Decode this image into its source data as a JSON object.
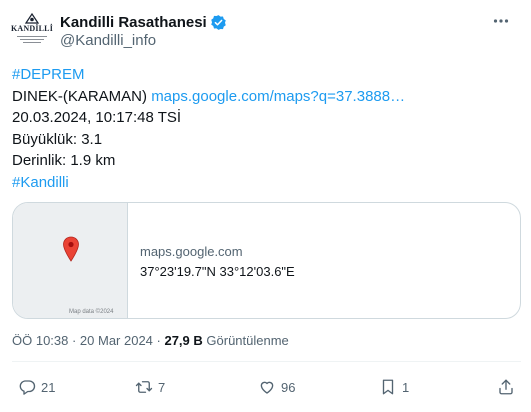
{
  "account": {
    "display_name": "Kandilli Rasathanesi",
    "handle": "@Kandilli_info",
    "avatar_word": "KANDİLLİ",
    "verified": true
  },
  "tweet": {
    "hashtag_top": "#DEPREM",
    "location_text": "DINEK-(KARAMAN)",
    "location_link": "maps.google.com/maps?q=37.3888…",
    "datetime": "20.03.2024, 10:17:48 TSİ",
    "magnitude": "Büyüklük: 3.1",
    "depth": "Derinlik: 1.9 km",
    "hashtag_bottom": "#Kandilli"
  },
  "card": {
    "domain": "maps.google.com",
    "coordinates": "37°23'19.7\"N 33°12'03.6\"E",
    "map_attribution": "Map data ©2024"
  },
  "meta": {
    "time": "ÖÖ 10:38 · 20 Mar 2024 · ",
    "views_count": "27,9 B",
    "views_label": " Görüntülenme"
  },
  "actions": {
    "replies": "21",
    "retweets": "7",
    "likes": "96",
    "bookmarks": "1"
  },
  "colors": {
    "accent": "#1d9bf0",
    "text": "#0f1419",
    "secondary": "#536471",
    "pin": "#ea4335"
  }
}
